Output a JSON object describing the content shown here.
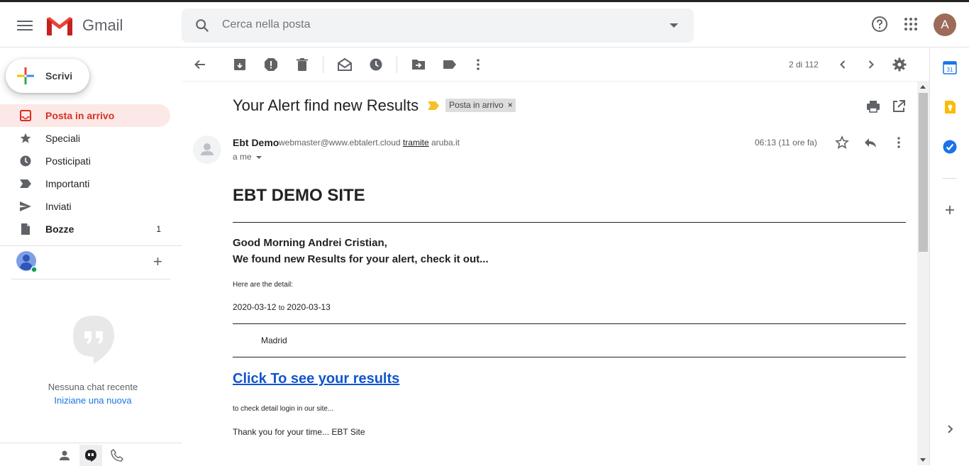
{
  "app": {
    "name": "Gmail"
  },
  "search": {
    "placeholder": "Cerca nella posta"
  },
  "header": {
    "avatar_letter": "A"
  },
  "compose": {
    "label": "Scrivi"
  },
  "nav": {
    "items": [
      {
        "label": "Posta in arrivo",
        "icon": "inbox-icon",
        "count": ""
      },
      {
        "label": "Speciali",
        "icon": "star-icon",
        "count": ""
      },
      {
        "label": "Posticipati",
        "icon": "clock-icon",
        "count": ""
      },
      {
        "label": "Importanti",
        "icon": "important-icon",
        "count": ""
      },
      {
        "label": "Inviati",
        "icon": "send-icon",
        "count": ""
      },
      {
        "label": "Bozze",
        "icon": "draft-icon",
        "count": "1"
      }
    ]
  },
  "chat": {
    "empty_text": "Nessuna chat recente",
    "start_link": "Iniziane una nuova"
  },
  "toolbar": {
    "pager": "2 di 112"
  },
  "message": {
    "subject": "Your Alert find new Results",
    "label": "Posta in arrivo",
    "sender_name": "Ebt Demo",
    "sender_email": "webmaster@www.ebtalert.cloud",
    "via_word": "tramite",
    "via_domain": "aruba.it",
    "recipient": "a me",
    "time": "06:13 (11 ore fa)"
  },
  "email_body": {
    "title": "EBT DEMO SITE",
    "greeting": "Good Morning Andrei Cristian,",
    "found_line": "We found new Results for your alert, check it out...",
    "detail_label": "Here are the detail:",
    "date_from": "2020-03-12",
    "date_to_word": "to",
    "date_to": "2020-03-13",
    "city": "Madrid",
    "link_text": "Click To see your results",
    "login_note": "to check detail login in our site...",
    "thanks": "Thank you for your time... EBT Site"
  },
  "colors": {
    "accent_red": "#d93025",
    "active_bg": "#fce8e6",
    "link_blue": "#1155cc",
    "important_marker": "#f6c026"
  }
}
